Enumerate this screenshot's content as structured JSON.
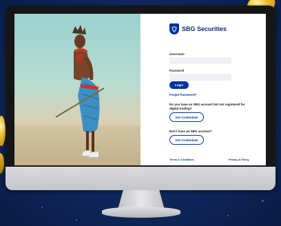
{
  "brand": {
    "name": "SBG Securities",
    "color": "#0033a1"
  },
  "login": {
    "username_label": "Username",
    "password_label": "Password",
    "login_button": "Login",
    "forgot_password": "Forgot Password?"
  },
  "register": {
    "existing_prompt": "Do you have an SBG account but not registered for digital trading?",
    "existing_button": "Get Credentials",
    "new_prompt": "Don't have an SBG account?",
    "new_button": "Get Credentials"
  },
  "footer": {
    "terms": "Terms & Conditions",
    "privacy": "Privacy & Policy"
  }
}
